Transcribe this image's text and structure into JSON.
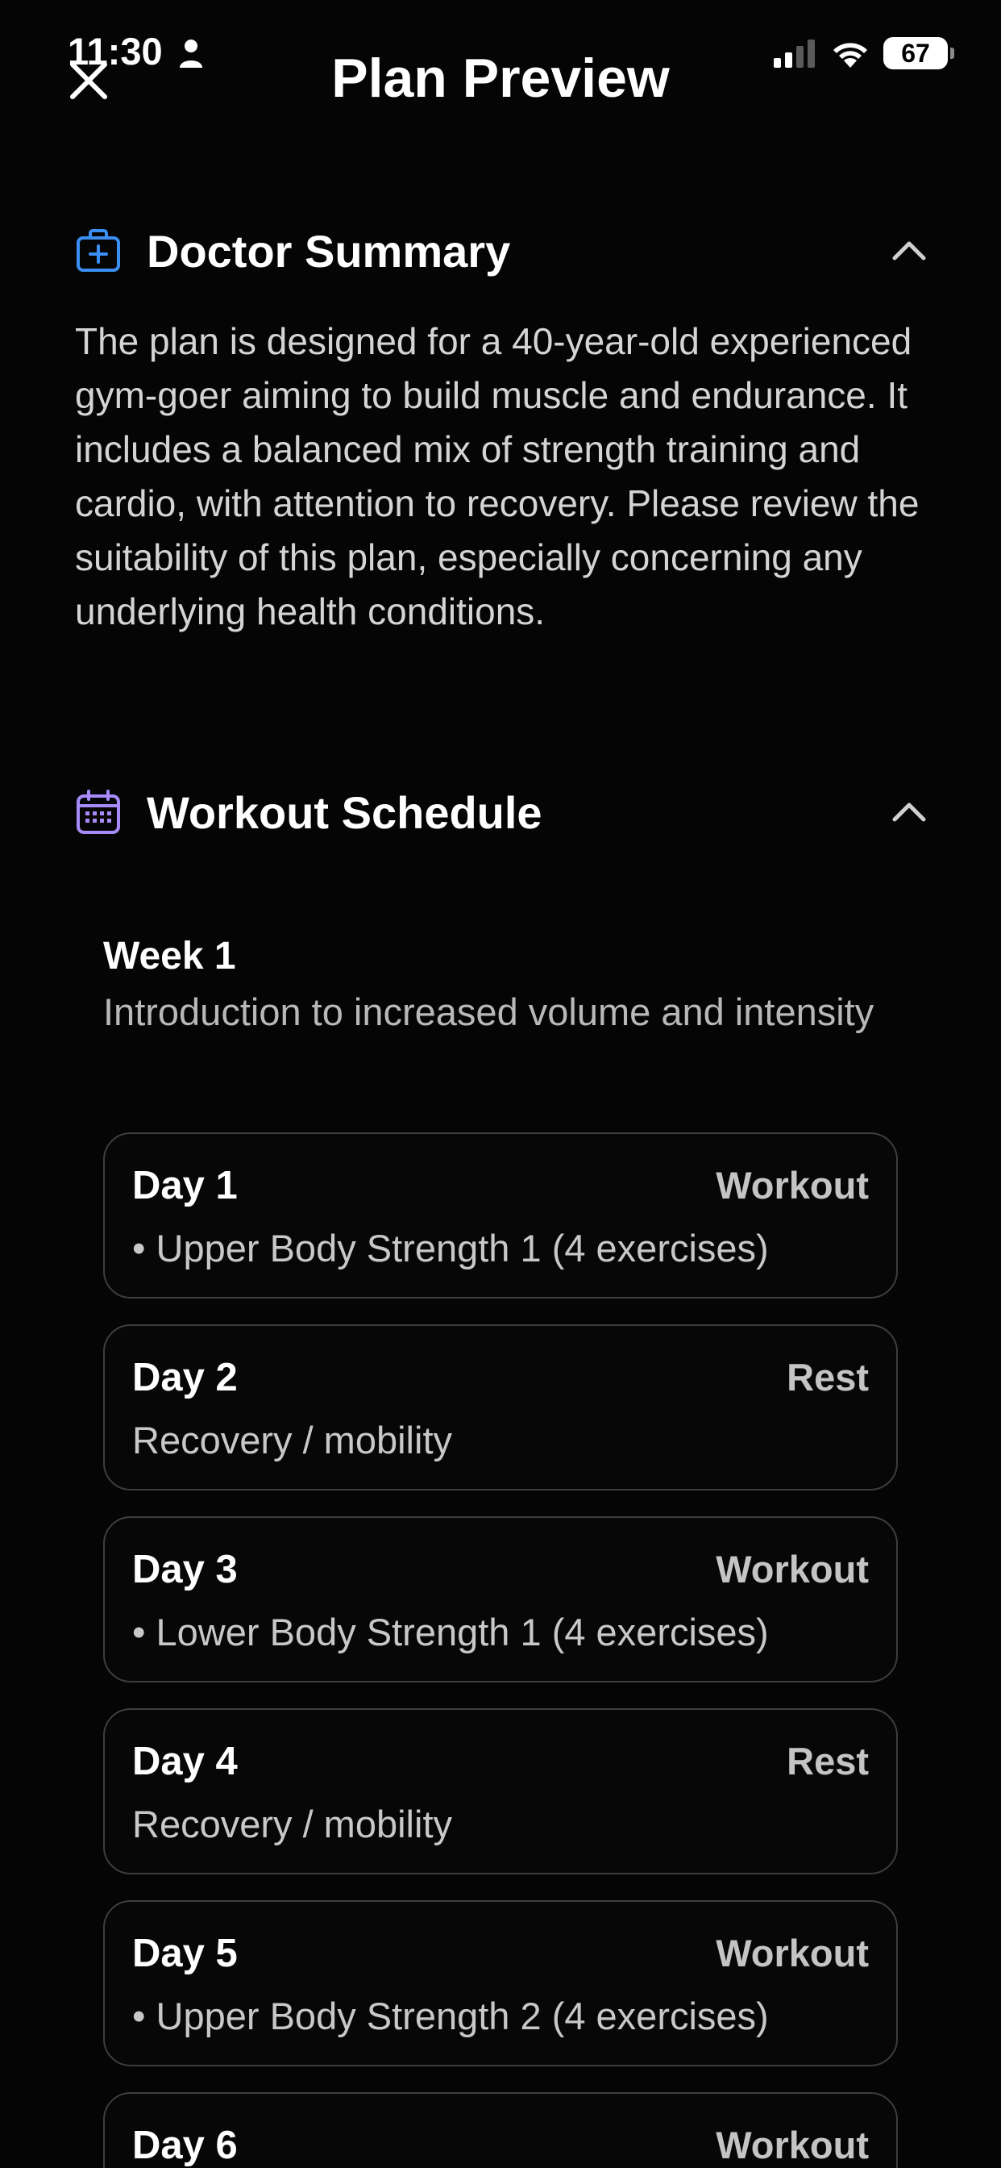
{
  "status_bar": {
    "time": "11:30",
    "battery": "67",
    "icons": [
      "person-icon",
      "signal-icon",
      "wifi-icon",
      "battery-icon"
    ]
  },
  "header": {
    "title": "Plan Preview",
    "close_icon": "close-icon"
  },
  "doctor_summary": {
    "title": "Doctor Summary",
    "icon": "medical-bag-icon",
    "text": "The plan is designed for a 40-year-old experienced gym-goer aiming to build muscle and endurance. It includes a balanced mix of strength training and cardio, with attention to recovery. Please review the suitability of this plan, especially concerning any underlying health conditions."
  },
  "workout_schedule": {
    "title": "Workout Schedule",
    "icon": "calendar-icon",
    "weeks": [
      {
        "title": "Week 1",
        "subtitle": "Introduction to increased volume and intensity",
        "days": [
          {
            "label": "Day 1",
            "type": "Workout",
            "detail": "• Upper Body Strength 1 (4 exercises)"
          },
          {
            "label": "Day 2",
            "type": "Rest",
            "detail": "Recovery / mobility"
          },
          {
            "label": "Day 3",
            "type": "Workout",
            "detail": "• Lower Body Strength 1 (4 exercises)"
          },
          {
            "label": "Day 4",
            "type": "Rest",
            "detail": "Recovery / mobility"
          },
          {
            "label": "Day 5",
            "type": "Workout",
            "detail": "• Upper Body Strength 2 (4 exercises)"
          },
          {
            "label": "Day 6",
            "type": "Workout",
            "detail": ""
          }
        ]
      }
    ]
  },
  "colors": {
    "background": "#050505",
    "accent_blue": "#3b8ff3",
    "accent_purple": "#a78bfa",
    "card_border": "#3e3e40"
  }
}
